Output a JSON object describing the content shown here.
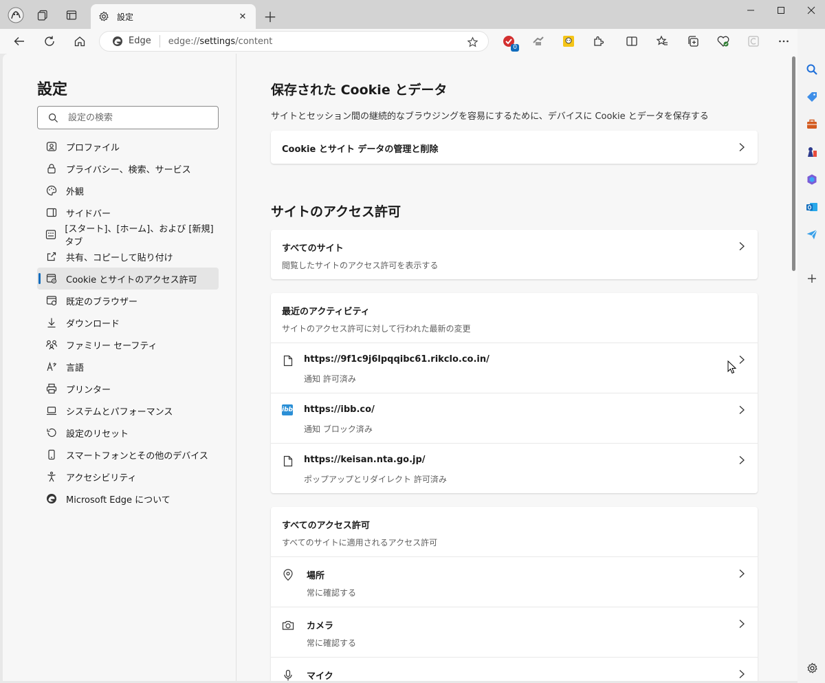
{
  "tab": {
    "title": "設定"
  },
  "address": {
    "site_label": "Edge",
    "url_prefix": "edge://",
    "url_bold": "settings",
    "url_suffix": "/content"
  },
  "toolbar": {
    "ext_badge": "0"
  },
  "settings": {
    "title": "設定",
    "search_placeholder": "設定の検索",
    "nav": [
      {
        "label": "プロファイル",
        "icon": "profile-icon"
      },
      {
        "label": "プライバシー、検索、サービス",
        "icon": "lock-icon"
      },
      {
        "label": "外観",
        "icon": "palette-icon"
      },
      {
        "label": "サイドバー",
        "icon": "sidebar-icon"
      },
      {
        "label": "[スタート]、[ホーム]、および [新規] タブ",
        "icon": "home-grid-icon"
      },
      {
        "label": "共有、コピーして貼り付け",
        "icon": "share-icon"
      },
      {
        "label": "Cookie とサイトのアクセス許可",
        "icon": "cookie-settings-icon",
        "active": true
      },
      {
        "label": "既定のブラウザー",
        "icon": "browser-icon"
      },
      {
        "label": "ダウンロード",
        "icon": "download-icon"
      },
      {
        "label": "ファミリー セーフティ",
        "icon": "family-icon"
      },
      {
        "label": "言語",
        "icon": "language-icon"
      },
      {
        "label": "プリンター",
        "icon": "printer-icon"
      },
      {
        "label": "システムとパフォーマンス",
        "icon": "laptop-icon"
      },
      {
        "label": "設定のリセット",
        "icon": "reset-icon"
      },
      {
        "label": "スマートフォンとその他のデバイス",
        "icon": "phone-icon"
      },
      {
        "label": "アクセシビリティ",
        "icon": "accessibility-icon"
      },
      {
        "label": "Microsoft Edge について",
        "icon": "edge-logo-icon"
      }
    ]
  },
  "content": {
    "cookies": {
      "title": "保存された Cookie とデータ",
      "desc": "サイトとセッション間の継続的なブラウジングを容易にするために、デバイスに Cookie とデータを保存する",
      "manage_label": "Cookie とサイト データの管理と削除"
    },
    "permissions": {
      "title": "サイトのアクセス許可",
      "all_sites": {
        "title": "すべてのサイト",
        "sub": "閲覧したサイトのアクセス許可を表示する"
      },
      "recent": {
        "title": "最近のアクティビティ",
        "sub": "サイトのアクセス許可に対して行われた最新の変更",
        "items": [
          {
            "url": "https://9f1c9j6lpqqibc61.rikclo.co.in/",
            "detail": "通知 許可済み",
            "icon": "page-icon"
          },
          {
            "url": "https://ibb.co/",
            "detail": "通知 ブロック済み",
            "icon": "ibb-favicon",
            "favicon_text": "ibb"
          },
          {
            "url": "https://keisan.nta.go.jp/",
            "detail": "ポップアップとリダイレクト 許可済み",
            "icon": "page-icon"
          }
        ]
      },
      "all_permissions": {
        "title": "すべてのアクセス許可",
        "sub": "すべてのサイトに適用されるアクセス許可",
        "items": [
          {
            "label": "場所",
            "detail": "常に確認する",
            "icon": "location-icon"
          },
          {
            "label": "カメラ",
            "detail": "常に確認する",
            "icon": "camera-icon"
          },
          {
            "label": "マイク",
            "detail": "",
            "icon": "microphone-icon"
          }
        ]
      }
    }
  },
  "colors": {
    "accent": "#0f6cbd",
    "ibb_favicon": "#2b8fd6"
  }
}
